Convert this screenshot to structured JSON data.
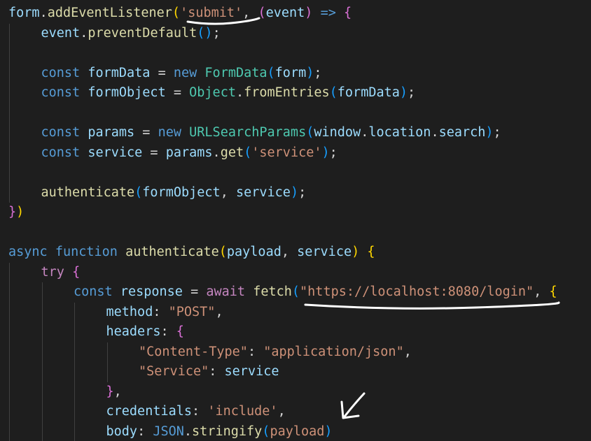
{
  "code_lines": [
    {
      "row": 0,
      "indent": 0,
      "tokens": [
        {
          "t": "form",
          "c": "tok-var"
        },
        {
          "t": ".",
          "c": "tok-punc"
        },
        {
          "t": "addEventListener",
          "c": "tok-fn"
        },
        {
          "t": "(",
          "c": "b1"
        },
        {
          "t": "'submit'",
          "c": "tok-str"
        },
        {
          "t": ", ",
          "c": "tok-punc"
        },
        {
          "t": "(",
          "c": "b2"
        },
        {
          "t": "event",
          "c": "tok-var"
        },
        {
          "t": ")",
          "c": "b2"
        },
        {
          "t": " => ",
          "c": "tok-kw"
        },
        {
          "t": "{",
          "c": "b2"
        }
      ]
    },
    {
      "row": 1,
      "indent": 1,
      "tokens": [
        {
          "t": "event",
          "c": "tok-var"
        },
        {
          "t": ".",
          "c": "tok-punc"
        },
        {
          "t": "preventDefault",
          "c": "tok-fn"
        },
        {
          "t": "()",
          "c": "b3"
        },
        {
          "t": ";",
          "c": "tok-punc"
        }
      ]
    },
    {
      "row": 3,
      "indent": 1,
      "tokens": [
        {
          "t": "const ",
          "c": "tok-kw"
        },
        {
          "t": "formData",
          "c": "tok-var"
        },
        {
          "t": " = ",
          "c": "tok-punc"
        },
        {
          "t": "new ",
          "c": "tok-kw"
        },
        {
          "t": "FormData",
          "c": "tok-type"
        },
        {
          "t": "(",
          "c": "b3"
        },
        {
          "t": "form",
          "c": "tok-var"
        },
        {
          "t": ")",
          "c": "b3"
        },
        {
          "t": ";",
          "c": "tok-punc"
        }
      ]
    },
    {
      "row": 4,
      "indent": 1,
      "tokens": [
        {
          "t": "const ",
          "c": "tok-kw"
        },
        {
          "t": "formObject",
          "c": "tok-var"
        },
        {
          "t": " = ",
          "c": "tok-punc"
        },
        {
          "t": "Object",
          "c": "tok-type"
        },
        {
          "t": ".",
          "c": "tok-punc"
        },
        {
          "t": "fromEntries",
          "c": "tok-fn"
        },
        {
          "t": "(",
          "c": "b3"
        },
        {
          "t": "formData",
          "c": "tok-var"
        },
        {
          "t": ")",
          "c": "b3"
        },
        {
          "t": ";",
          "c": "tok-punc"
        }
      ]
    },
    {
      "row": 6,
      "indent": 1,
      "tokens": [
        {
          "t": "const ",
          "c": "tok-kw"
        },
        {
          "t": "params",
          "c": "tok-var"
        },
        {
          "t": " = ",
          "c": "tok-punc"
        },
        {
          "t": "new ",
          "c": "tok-kw"
        },
        {
          "t": "URLSearchParams",
          "c": "tok-type"
        },
        {
          "t": "(",
          "c": "b3"
        },
        {
          "t": "window",
          "c": "tok-var"
        },
        {
          "t": ".",
          "c": "tok-punc"
        },
        {
          "t": "location",
          "c": "tok-var"
        },
        {
          "t": ".",
          "c": "tok-punc"
        },
        {
          "t": "search",
          "c": "tok-var"
        },
        {
          "t": ")",
          "c": "b3"
        },
        {
          "t": ";",
          "c": "tok-punc"
        }
      ]
    },
    {
      "row": 7,
      "indent": 1,
      "tokens": [
        {
          "t": "const ",
          "c": "tok-kw"
        },
        {
          "t": "service",
          "c": "tok-var"
        },
        {
          "t": " = ",
          "c": "tok-punc"
        },
        {
          "t": "params",
          "c": "tok-var"
        },
        {
          "t": ".",
          "c": "tok-punc"
        },
        {
          "t": "get",
          "c": "tok-fn"
        },
        {
          "t": "(",
          "c": "b3"
        },
        {
          "t": "'service'",
          "c": "tok-str"
        },
        {
          "t": ")",
          "c": "b3"
        },
        {
          "t": ";",
          "c": "tok-punc"
        }
      ]
    },
    {
      "row": 9,
      "indent": 1,
      "tokens": [
        {
          "t": "authenticate",
          "c": "tok-fn"
        },
        {
          "t": "(",
          "c": "b3"
        },
        {
          "t": "formObject",
          "c": "tok-var"
        },
        {
          "t": ", ",
          "c": "tok-punc"
        },
        {
          "t": "service",
          "c": "tok-var"
        },
        {
          "t": ")",
          "c": "b3"
        },
        {
          "t": ";",
          "c": "tok-punc"
        }
      ]
    },
    {
      "row": 10,
      "indent": 0,
      "tokens": [
        {
          "t": "}",
          "c": "b2"
        },
        {
          "t": ")",
          "c": "b1"
        }
      ]
    },
    {
      "row": 12,
      "indent": 0,
      "tokens": [
        {
          "t": "async ",
          "c": "tok-kw"
        },
        {
          "t": "function ",
          "c": "tok-kw"
        },
        {
          "t": "authenticate",
          "c": "tok-fn"
        },
        {
          "t": "(",
          "c": "b1"
        },
        {
          "t": "payload",
          "c": "tok-var"
        },
        {
          "t": ", ",
          "c": "tok-punc"
        },
        {
          "t": "service",
          "c": "tok-var"
        },
        {
          "t": ")",
          "c": "b1"
        },
        {
          "t": " ",
          "c": "tok-punc"
        },
        {
          "t": "{",
          "c": "b1"
        }
      ]
    },
    {
      "row": 13,
      "indent": 1,
      "tokens": [
        {
          "t": "try ",
          "c": "tok-ctl"
        },
        {
          "t": "{",
          "c": "b2"
        }
      ]
    },
    {
      "row": 14,
      "indent": 2,
      "tokens": [
        {
          "t": "const ",
          "c": "tok-kw"
        },
        {
          "t": "response",
          "c": "tok-var"
        },
        {
          "t": " = ",
          "c": "tok-punc"
        },
        {
          "t": "await ",
          "c": "tok-ctl"
        },
        {
          "t": "fetch",
          "c": "tok-fn"
        },
        {
          "t": "(",
          "c": "b3"
        },
        {
          "t": "\"https://localhost:8080/login\"",
          "c": "tok-str"
        },
        {
          "t": ", ",
          "c": "tok-punc"
        },
        {
          "t": "{",
          "c": "b1"
        }
      ]
    },
    {
      "row": 15,
      "indent": 3,
      "tokens": [
        {
          "t": "method",
          "c": "tok-var"
        },
        {
          "t": ": ",
          "c": "tok-punc"
        },
        {
          "t": "\"POST\"",
          "c": "tok-str"
        },
        {
          "t": ",",
          "c": "tok-punc"
        }
      ]
    },
    {
      "row": 16,
      "indent": 3,
      "tokens": [
        {
          "t": "headers",
          "c": "tok-var"
        },
        {
          "t": ": ",
          "c": "tok-punc"
        },
        {
          "t": "{",
          "c": "b2"
        }
      ]
    },
    {
      "row": 17,
      "indent": 4,
      "tokens": [
        {
          "t": "\"Content-Type\"",
          "c": "tok-str"
        },
        {
          "t": ": ",
          "c": "tok-punc"
        },
        {
          "t": "\"application/json\"",
          "c": "tok-str"
        },
        {
          "t": ",",
          "c": "tok-punc"
        }
      ]
    },
    {
      "row": 18,
      "indent": 4,
      "tokens": [
        {
          "t": "\"Service\"",
          "c": "tok-str"
        },
        {
          "t": ": ",
          "c": "tok-punc"
        },
        {
          "t": "service",
          "c": "tok-var"
        }
      ]
    },
    {
      "row": 19,
      "indent": 3,
      "tokens": [
        {
          "t": "}",
          "c": "b2"
        },
        {
          "t": ",",
          "c": "tok-punc"
        }
      ]
    },
    {
      "row": 20,
      "indent": 3,
      "tokens": [
        {
          "t": "credentials",
          "c": "tok-var"
        },
        {
          "t": ": ",
          "c": "tok-punc"
        },
        {
          "t": "'include'",
          "c": "tok-str"
        },
        {
          "t": ",",
          "c": "tok-punc"
        }
      ]
    },
    {
      "row": 21,
      "indent": 3,
      "tokens": [
        {
          "t": "body",
          "c": "tok-var"
        },
        {
          "t": ": ",
          "c": "tok-punc"
        },
        {
          "t": "JSON",
          "c": "tok-kw"
        },
        {
          "t": ".",
          "c": "tok-punc"
        },
        {
          "t": "stringify",
          "c": "tok-fn"
        },
        {
          "t": "(",
          "c": "b3"
        },
        {
          "t": "payload",
          "c": "tok-str"
        },
        {
          "t": ")",
          "c": "b3"
        }
      ]
    }
  ],
  "colors": {
    "background": "#1e1e1e",
    "annotation_ink": "#ffffff",
    "indent_guide": "#404040"
  },
  "annotations": [
    {
      "kind": "underline",
      "target": "'submit'"
    },
    {
      "kind": "underline",
      "target": "\"https://localhost:8080/login\""
    },
    {
      "kind": "arrow",
      "target": "payload"
    }
  ]
}
